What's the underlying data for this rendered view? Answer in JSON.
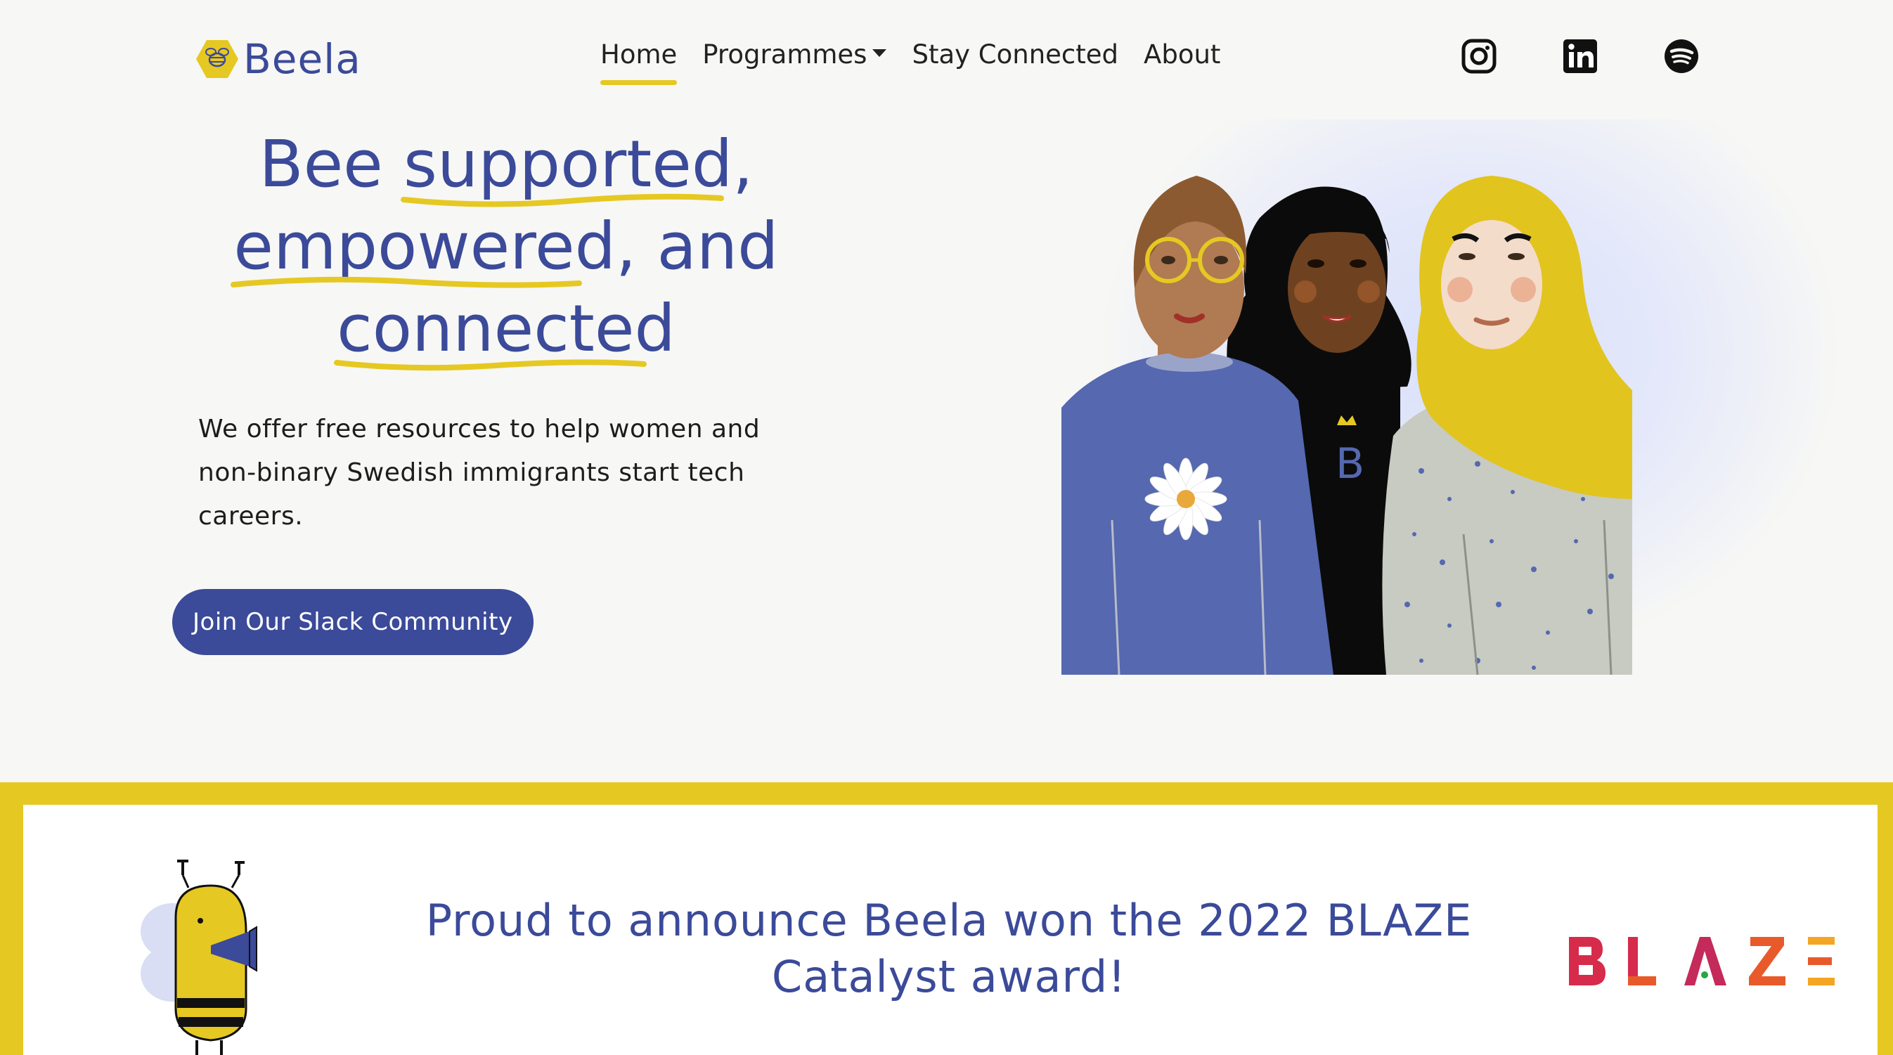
{
  "brand": {
    "name": "Beela",
    "logo_icon": "hexagon-bee-icon"
  },
  "nav": {
    "items": [
      {
        "label": "Home",
        "active": true
      },
      {
        "label": "Programmes",
        "has_dropdown": true
      },
      {
        "label": "Stay Connected"
      },
      {
        "label": "About"
      }
    ],
    "social": [
      "instagram-icon",
      "linkedin-icon",
      "spotify-icon"
    ]
  },
  "hero": {
    "headline": {
      "word1": "Bee ",
      "word2": "supported",
      "word3": ",",
      "word4": "empowered",
      "word5": ", and",
      "word6": "connected"
    },
    "intro": "We offer free resources to help women and non-binary Swedish immigrants start tech careers.",
    "cta": "Join Our Slack Community"
  },
  "award": {
    "text": "Proud to announce Beela won the 2022 BLAZE Catalyst award!",
    "partner_logo": "BLAZE"
  },
  "colors": {
    "brand_blue": "#3b4a99",
    "accent_yellow": "#e6c822",
    "page_bg": "#f7f7f5"
  }
}
